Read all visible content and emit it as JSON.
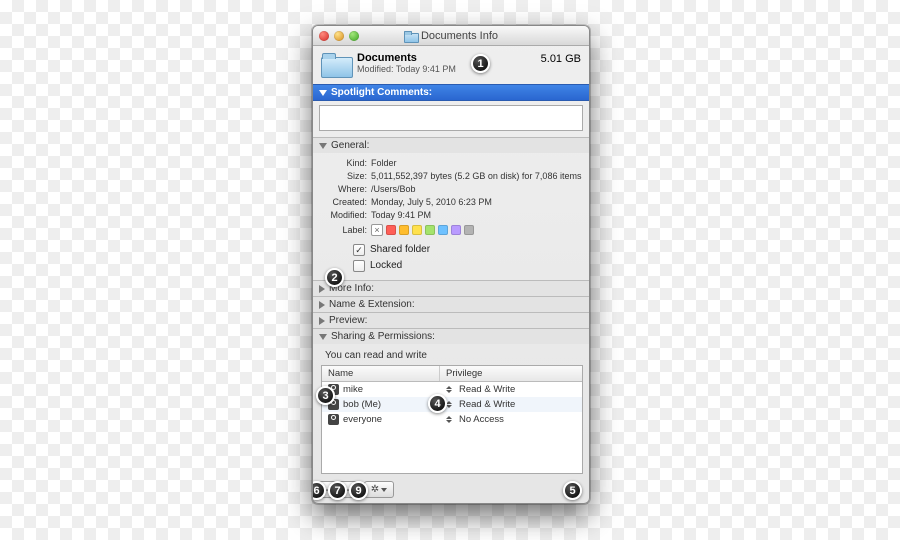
{
  "window": {
    "title": "Documents Info"
  },
  "header": {
    "name": "Documents",
    "modified_line": "Modified: Today 9:41 PM",
    "size": "5.01 GB"
  },
  "sections": {
    "spotlight": "Spotlight Comments:",
    "general": "General:",
    "more_info": "More Info:",
    "name_ext": "Name & Extension:",
    "preview": "Preview:",
    "sharing": "Sharing & Permissions:"
  },
  "general": {
    "kind_k": "Kind:",
    "kind_v": "Folder",
    "size_k": "Size:",
    "size_v": "5,011,552,397 bytes (5.2 GB on disk) for 7,086 items",
    "where_k": "Where:",
    "where_v": "/Users/Bob",
    "created_k": "Created:",
    "created_v": "Monday, July 5, 2010 6:23 PM",
    "modified_k": "Modified:",
    "modified_v": "Today 9:41 PM",
    "label_k": "Label:",
    "label_colors": [
      "#ff5f57",
      "#ffbd2e",
      "#ffe14d",
      "#a4e36c",
      "#6ec1ff",
      "#b99bff",
      "#b3b3b3"
    ],
    "shared_label": "Shared folder",
    "shared_checked": true,
    "locked_label": "Locked",
    "locked_checked": false
  },
  "sharing": {
    "summary": "You can read and write",
    "col_name": "Name",
    "col_priv": "Privilege",
    "rows": [
      {
        "name": "mike",
        "priv": "Read & Write"
      },
      {
        "name": "bob (Me)",
        "priv": "Read & Write"
      },
      {
        "name": "everyone",
        "priv": "No Access"
      }
    ]
  },
  "footer": {
    "add": "+",
    "remove": "−",
    "gear": "✻"
  },
  "markers": {
    "1": "1",
    "2": "2",
    "3": "3",
    "4": "4",
    "5": "5",
    "6": "6",
    "7": "7",
    "9": "9"
  }
}
